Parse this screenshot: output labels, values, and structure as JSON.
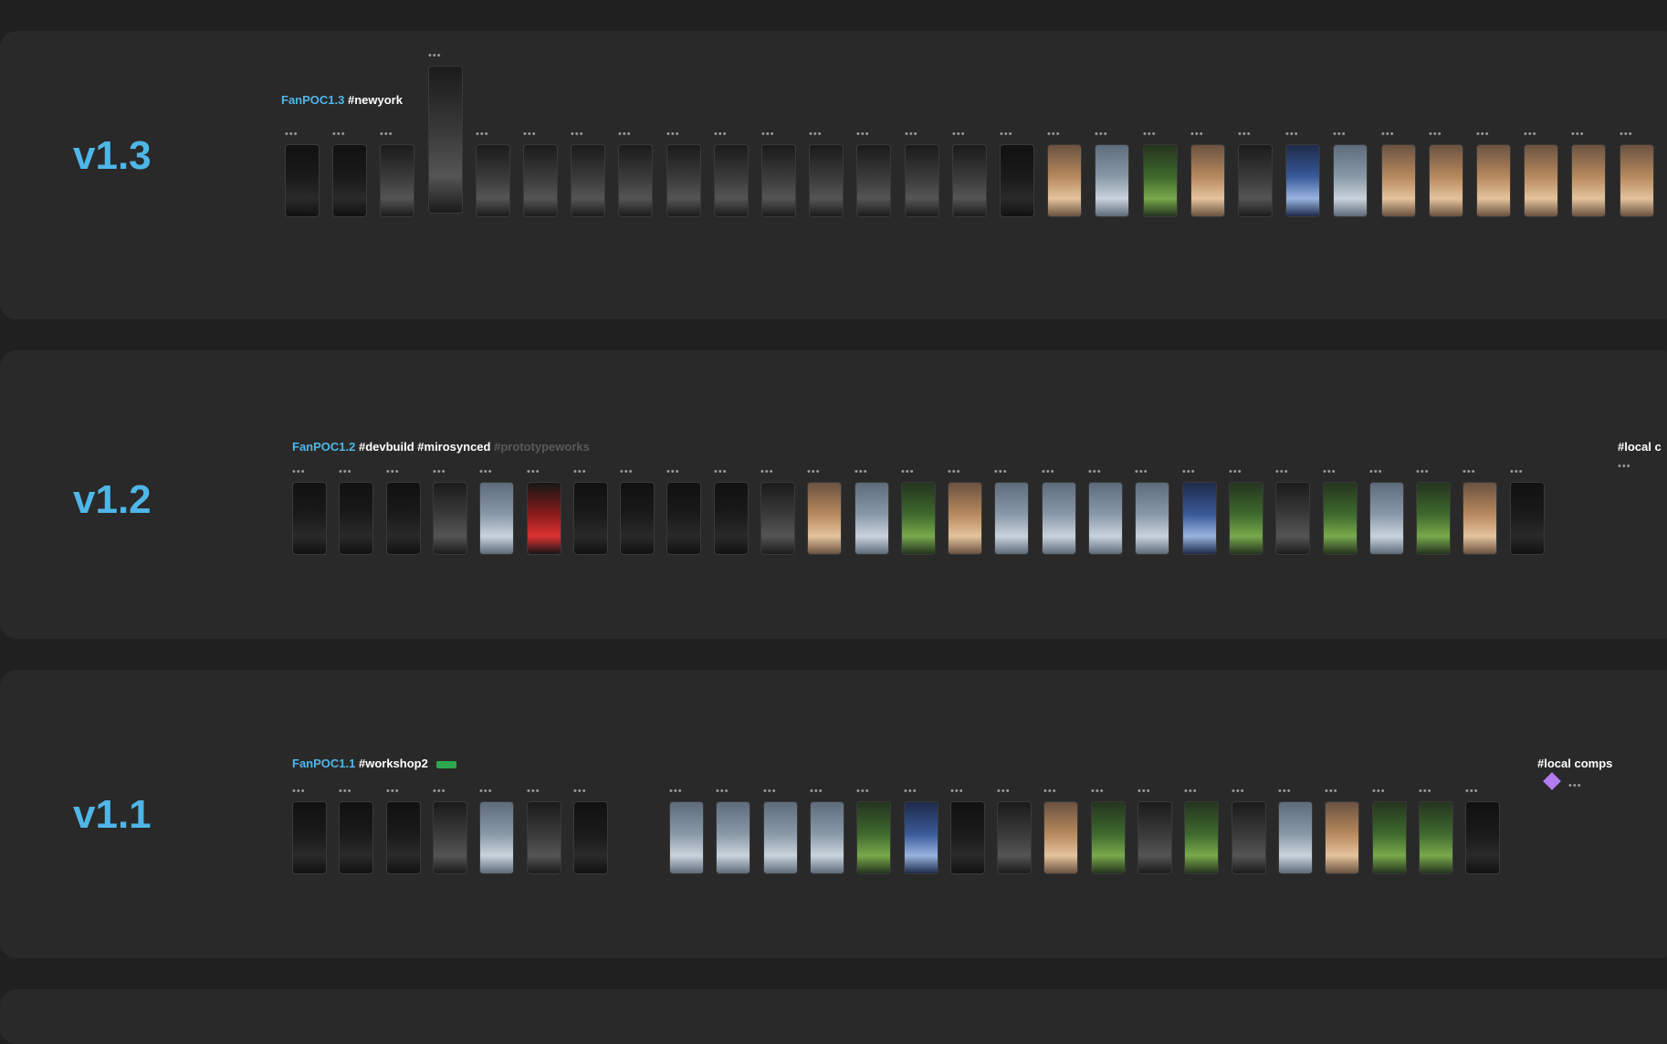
{
  "sections": [
    {
      "version": "v1.3",
      "flow_name": "FanPOC1.3",
      "flow_tags": "#newyork",
      "flow_tags_dim": "",
      "frame_count": 30
    },
    {
      "version": "v1.2",
      "flow_name": "FanPOC1.2",
      "flow_tags": "#devbuild #mirosynced",
      "flow_tags_dim": "#prototypeworks",
      "frame_count": 27,
      "side_label": "#local c"
    },
    {
      "version": "v1.1",
      "flow_name": "FanPOC1.1",
      "flow_tags": "#workshop2",
      "flow_tags_dim": "",
      "frame_count": 25,
      "side_label": "#local comps"
    }
  ],
  "frame_dots": "•••",
  "colors": {
    "background": "#202020",
    "section": "#292929",
    "accent": "#4fb6e8",
    "component": "#b37cf0",
    "badge": "#2ea84f"
  },
  "icons": {
    "component": "diamond-icon",
    "more": "ellipsis-icon"
  }
}
